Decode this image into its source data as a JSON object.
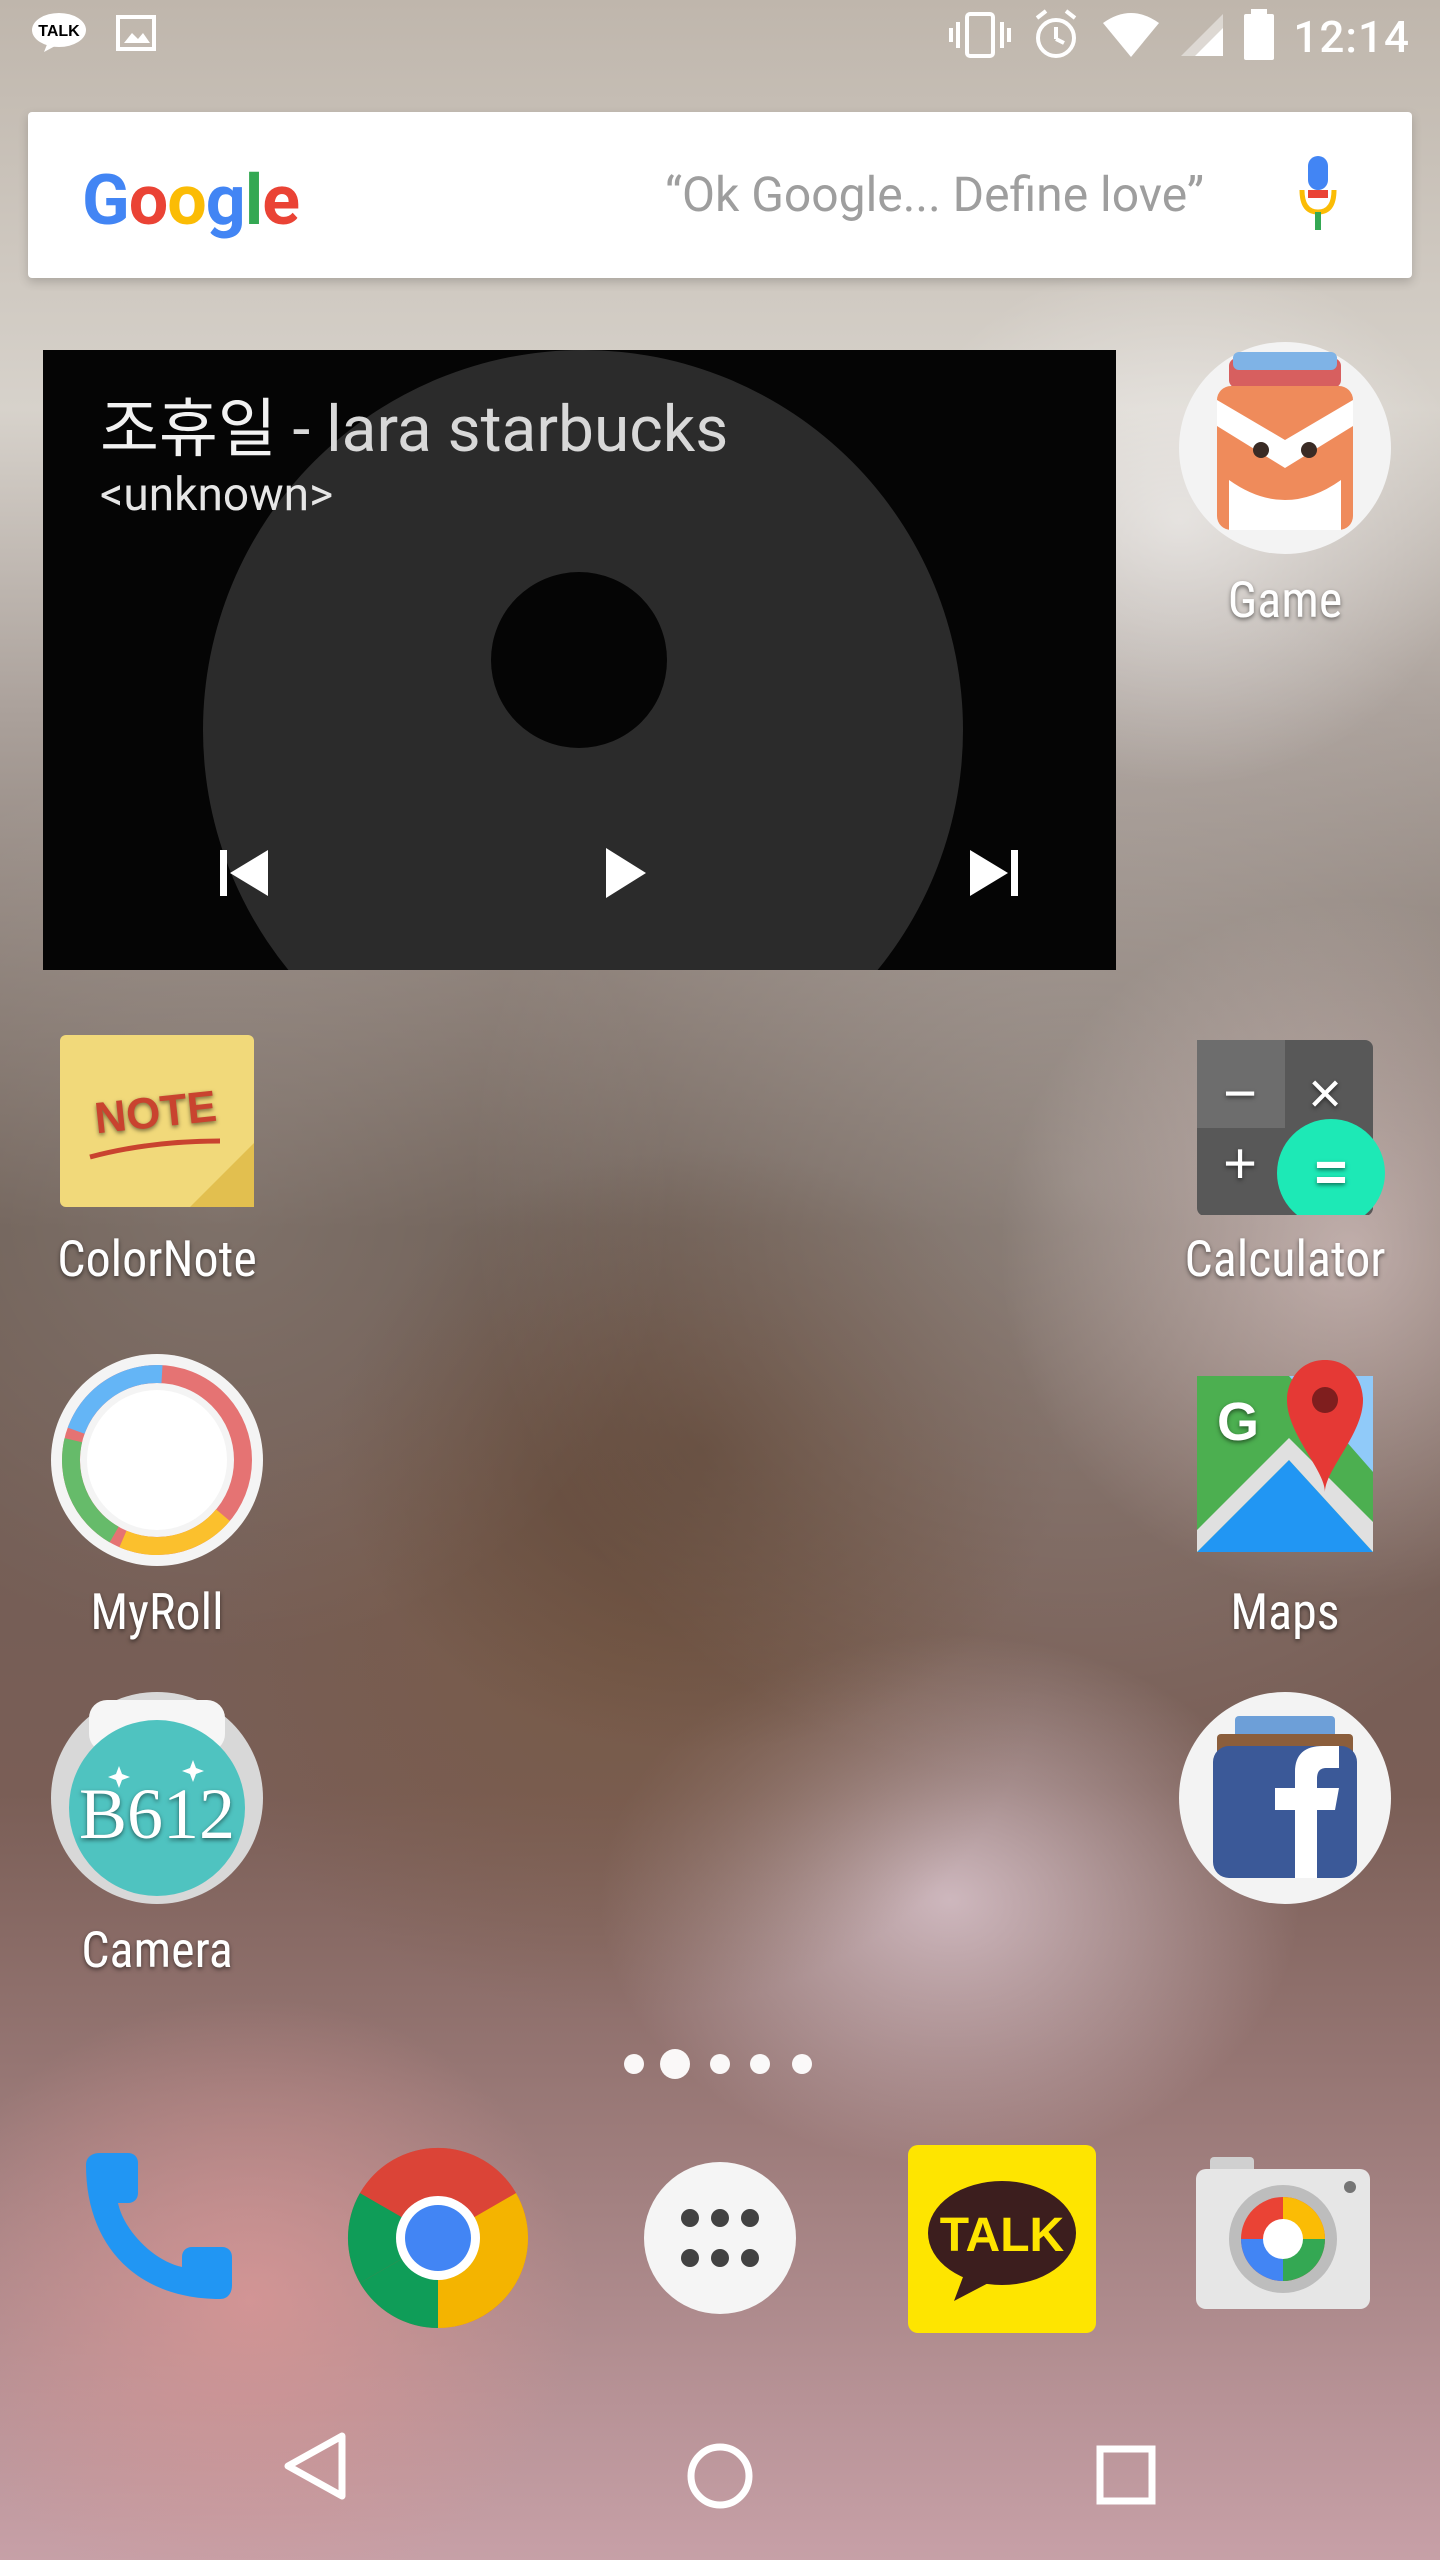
{
  "status_bar": {
    "time": "12:14",
    "left_icons": [
      "talk-notification-icon",
      "image-notification-icon"
    ],
    "right_icons": [
      "vibrate-icon",
      "alarm-icon",
      "wifi-icon",
      "signal-icon",
      "battery-icon"
    ]
  },
  "search": {
    "brand": "Google",
    "hint": "“Ok Google... Define love”"
  },
  "music_widget": {
    "song_title": "조휴일",
    "song_artist": " - lara starbucks",
    "album": "<unknown>"
  },
  "apps": {
    "game": "Game",
    "colornote": "ColorNote",
    "calculator": "Calculator",
    "myroll": "MyRoll",
    "maps": "Maps",
    "camera": "Camera",
    "facebook": ""
  },
  "dock": {
    "items": [
      "Phone",
      "Chrome",
      "Apps",
      "KakaoTalk",
      "Google Camera"
    ]
  },
  "page_indicator": {
    "count": 5,
    "active_index": 1
  },
  "nav_bar": {
    "back": "Back",
    "home": "Home",
    "recents": "Recents"
  },
  "colors": {
    "calculator_green": "#1de9b6",
    "kakao_yellow": "#FEE500",
    "facebook_blue": "#3b5998"
  }
}
